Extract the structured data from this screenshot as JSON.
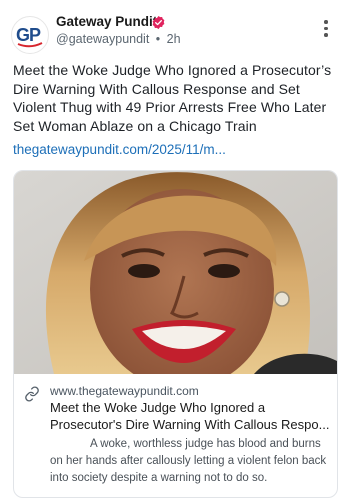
{
  "account": {
    "name": "Gateway Pundit",
    "handle": "@gatewaypundit",
    "separator": "•",
    "time": "2h",
    "avatar_text": "GP",
    "verified_color": "#e0245e",
    "avatar_colors": {
      "primary": "#1f4c8c",
      "secondary": "#d7262e"
    }
  },
  "post": {
    "text": "Meet the Woke Judge Who Ignored a Prosecutor’s Dire Warning With Callous Response and Set Violent Thug with 49 Prior Arrests Free Who Later Set Woman Ablaze on a Chicago Train",
    "link_text": "thegatewaypundit.com/2025/11/m..."
  },
  "card": {
    "image_alt": "photo of a woman with blonde hair smiling",
    "domain": "www.thegatewaypundit.com",
    "title": "Meet the Woke Judge Who Ignored a Prosecutor's Dire Warning With Callous Respo...",
    "description": "A woke, worthless judge has blood and burns on her hands after callously letting a violent felon back into society despite a warning not to do so."
  },
  "icons": {
    "verified": "verified-badge-icon",
    "menu": "more-vertical-icon",
    "link": "link-icon"
  },
  "colors": {
    "link": "#1d6fb8",
    "handle": "#5b6670",
    "text": "#1d2126"
  }
}
